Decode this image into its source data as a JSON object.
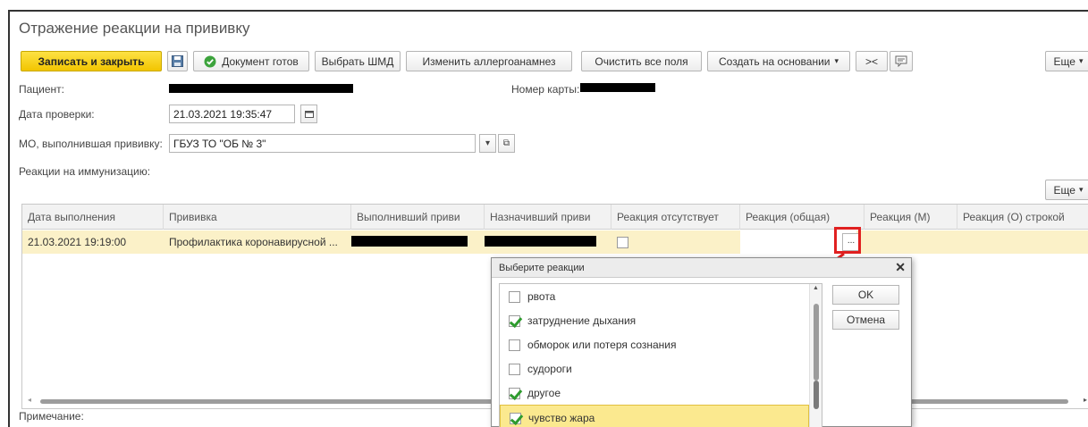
{
  "window": {
    "title": "Отражение реакции на прививку"
  },
  "toolbar": {
    "write_close": "Записать и закрыть",
    "doc_ready": "Документ готов",
    "choose_shmd": "Выбрать ШМД",
    "change_allergy": "Изменить аллергоанамнез",
    "clear_all": "Очистить все поля",
    "create_based": "Создать на основании",
    "swap": "><",
    "more": "Еще"
  },
  "form": {
    "patient_label": "Пациент:",
    "card_label": "Номер карты:",
    "check_date_label": "Дата проверки:",
    "check_date_value": "21.03.2021 19:35:47",
    "mo_label": "МО, выполнившая прививку:",
    "mo_value": "ГБУЗ ТО \"ОБ № 3\"",
    "reactions_label": "Реакции на иммунизацию:",
    "note_label": "Примечание:"
  },
  "table": {
    "more": "Еще",
    "columns": [
      "Дата выполнения",
      "Прививка",
      "Выполнивший приви",
      "Назначивший приви",
      "Реакция отсутствует",
      "Реакция (общая)",
      "Реакция (М)",
      "Реакция (О) строкой"
    ],
    "row": {
      "date": "21.03.2021 19:19:00",
      "vaccine": "Профилактика коронавирусной ...",
      "reaction_absent": false,
      "ellipsis": "..."
    }
  },
  "dialog": {
    "title": "Выберите реакции",
    "ok": "OK",
    "cancel": "Отмена",
    "items": [
      {
        "label": "рвота",
        "checked": false
      },
      {
        "label": "затруднение дыхания",
        "checked": true
      },
      {
        "label": "обморок или потеря сознания",
        "checked": false
      },
      {
        "label": "судороги",
        "checked": false
      },
      {
        "label": "другое",
        "checked": true
      },
      {
        "label": "чувство жара",
        "checked": true
      }
    ]
  },
  "colors": {
    "primary_button": "#f2c500",
    "selected_row": "#fbf1c8",
    "annotation": "#e02020"
  }
}
